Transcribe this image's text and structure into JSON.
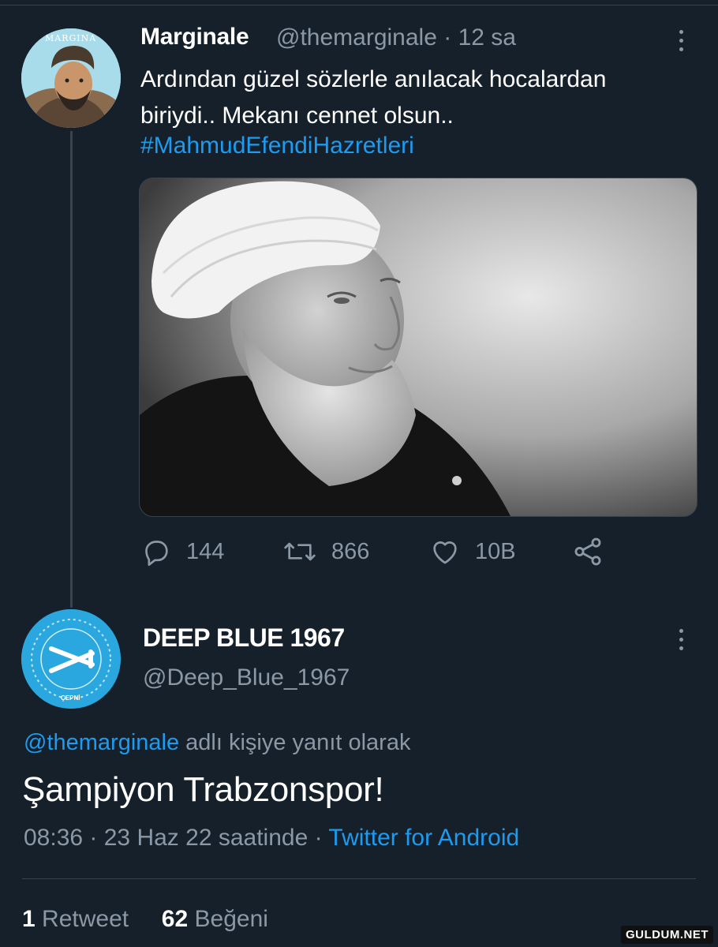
{
  "tweet": {
    "author_name": "Marginale",
    "author_handle": "@themarginale",
    "time_ago": "12 sa",
    "text_line1": "Ardından güzel sözlerle anılacak hocalardan",
    "text_line2": "biriydi.. Mekanı cennet olsun..",
    "hashtag": "#MahmudEfendiHazretleri",
    "avatar_logo_text": "MARGINA",
    "actions": {
      "replies": "144",
      "retweets": "866",
      "likes": "10B"
    }
  },
  "reply": {
    "author_name": "DEEP BLUE 1967",
    "author_handle": "@Deep_Blue_1967",
    "avatar_logo_text": "ÇEPNİ",
    "mention": "@themarginale",
    "reply_context": "adlı kişiye yanıt olarak",
    "text": "Şampiyon Trabzonspor!",
    "time": "08:36",
    "date": "23 Haz 22 saatinde",
    "source": "Twitter for Android",
    "retweet_count": "1",
    "retweet_label": "Retweet",
    "like_count": "62",
    "like_label": "Beğeni"
  },
  "watermark": "GULDUM.NET",
  "colors": {
    "background": "#15202b",
    "accent": "#1d9bf0",
    "muted": "#8b98a5",
    "divider": "#38444d"
  },
  "icons": [
    "reply-icon",
    "retweet-icon",
    "like-icon",
    "share-icon",
    "more-icon"
  ]
}
